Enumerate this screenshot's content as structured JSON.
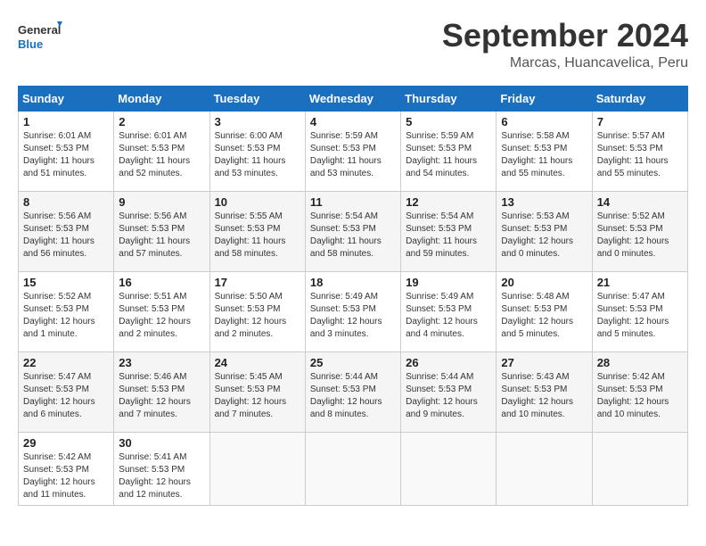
{
  "header": {
    "logo_general": "General",
    "logo_blue": "Blue",
    "month": "September 2024",
    "location": "Marcas, Huancavelica, Peru"
  },
  "weekdays": [
    "Sunday",
    "Monday",
    "Tuesday",
    "Wednesday",
    "Thursday",
    "Friday",
    "Saturday"
  ],
  "weeks": [
    [
      {
        "day": "1",
        "info": "Sunrise: 6:01 AM\nSunset: 5:53 PM\nDaylight: 11 hours\nand 51 minutes."
      },
      {
        "day": "2",
        "info": "Sunrise: 6:01 AM\nSunset: 5:53 PM\nDaylight: 11 hours\nand 52 minutes."
      },
      {
        "day": "3",
        "info": "Sunrise: 6:00 AM\nSunset: 5:53 PM\nDaylight: 11 hours\nand 53 minutes."
      },
      {
        "day": "4",
        "info": "Sunrise: 5:59 AM\nSunset: 5:53 PM\nDaylight: 11 hours\nand 53 minutes."
      },
      {
        "day": "5",
        "info": "Sunrise: 5:59 AM\nSunset: 5:53 PM\nDaylight: 11 hours\nand 54 minutes."
      },
      {
        "day": "6",
        "info": "Sunrise: 5:58 AM\nSunset: 5:53 PM\nDaylight: 11 hours\nand 55 minutes."
      },
      {
        "day": "7",
        "info": "Sunrise: 5:57 AM\nSunset: 5:53 PM\nDaylight: 11 hours\nand 55 minutes."
      }
    ],
    [
      {
        "day": "8",
        "info": "Sunrise: 5:56 AM\nSunset: 5:53 PM\nDaylight: 11 hours\nand 56 minutes."
      },
      {
        "day": "9",
        "info": "Sunrise: 5:56 AM\nSunset: 5:53 PM\nDaylight: 11 hours\nand 57 minutes."
      },
      {
        "day": "10",
        "info": "Sunrise: 5:55 AM\nSunset: 5:53 PM\nDaylight: 11 hours\nand 58 minutes."
      },
      {
        "day": "11",
        "info": "Sunrise: 5:54 AM\nSunset: 5:53 PM\nDaylight: 11 hours\nand 58 minutes."
      },
      {
        "day": "12",
        "info": "Sunrise: 5:54 AM\nSunset: 5:53 PM\nDaylight: 11 hours\nand 59 minutes."
      },
      {
        "day": "13",
        "info": "Sunrise: 5:53 AM\nSunset: 5:53 PM\nDaylight: 12 hours\nand 0 minutes."
      },
      {
        "day": "14",
        "info": "Sunrise: 5:52 AM\nSunset: 5:53 PM\nDaylight: 12 hours\nand 0 minutes."
      }
    ],
    [
      {
        "day": "15",
        "info": "Sunrise: 5:52 AM\nSunset: 5:53 PM\nDaylight: 12 hours\nand 1 minute."
      },
      {
        "day": "16",
        "info": "Sunrise: 5:51 AM\nSunset: 5:53 PM\nDaylight: 12 hours\nand 2 minutes."
      },
      {
        "day": "17",
        "info": "Sunrise: 5:50 AM\nSunset: 5:53 PM\nDaylight: 12 hours\nand 2 minutes."
      },
      {
        "day": "18",
        "info": "Sunrise: 5:49 AM\nSunset: 5:53 PM\nDaylight: 12 hours\nand 3 minutes."
      },
      {
        "day": "19",
        "info": "Sunrise: 5:49 AM\nSunset: 5:53 PM\nDaylight: 12 hours\nand 4 minutes."
      },
      {
        "day": "20",
        "info": "Sunrise: 5:48 AM\nSunset: 5:53 PM\nDaylight: 12 hours\nand 5 minutes."
      },
      {
        "day": "21",
        "info": "Sunrise: 5:47 AM\nSunset: 5:53 PM\nDaylight: 12 hours\nand 5 minutes."
      }
    ],
    [
      {
        "day": "22",
        "info": "Sunrise: 5:47 AM\nSunset: 5:53 PM\nDaylight: 12 hours\nand 6 minutes."
      },
      {
        "day": "23",
        "info": "Sunrise: 5:46 AM\nSunset: 5:53 PM\nDaylight: 12 hours\nand 7 minutes."
      },
      {
        "day": "24",
        "info": "Sunrise: 5:45 AM\nSunset: 5:53 PM\nDaylight: 12 hours\nand 7 minutes."
      },
      {
        "day": "25",
        "info": "Sunrise: 5:44 AM\nSunset: 5:53 PM\nDaylight: 12 hours\nand 8 minutes."
      },
      {
        "day": "26",
        "info": "Sunrise: 5:44 AM\nSunset: 5:53 PM\nDaylight: 12 hours\nand 9 minutes."
      },
      {
        "day": "27",
        "info": "Sunrise: 5:43 AM\nSunset: 5:53 PM\nDaylight: 12 hours\nand 10 minutes."
      },
      {
        "day": "28",
        "info": "Sunrise: 5:42 AM\nSunset: 5:53 PM\nDaylight: 12 hours\nand 10 minutes."
      }
    ],
    [
      {
        "day": "29",
        "info": "Sunrise: 5:42 AM\nSunset: 5:53 PM\nDaylight: 12 hours\nand 11 minutes."
      },
      {
        "day": "30",
        "info": "Sunrise: 5:41 AM\nSunset: 5:53 PM\nDaylight: 12 hours\nand 12 minutes."
      },
      {
        "day": "",
        "info": ""
      },
      {
        "day": "",
        "info": ""
      },
      {
        "day": "",
        "info": ""
      },
      {
        "day": "",
        "info": ""
      },
      {
        "day": "",
        "info": ""
      }
    ]
  ]
}
